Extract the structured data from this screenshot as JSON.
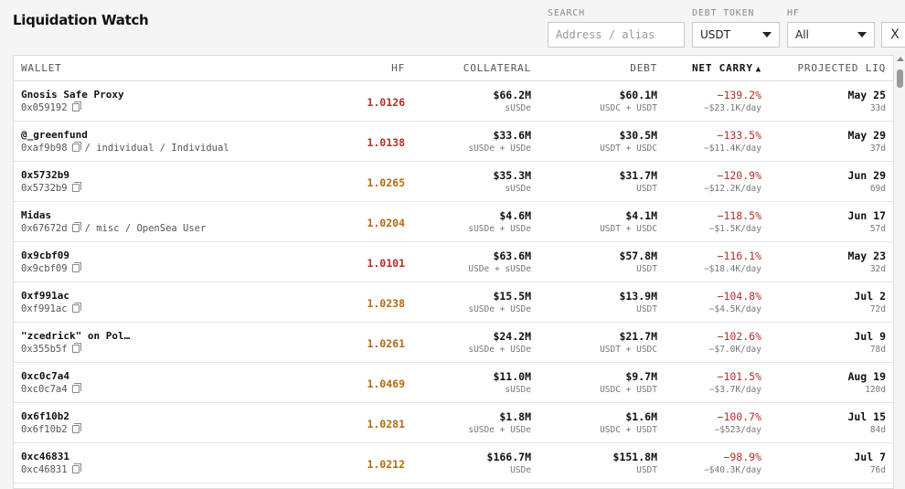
{
  "app": {
    "title": "Liquidation Watch"
  },
  "filters": {
    "search": {
      "label": "SEARCH",
      "placeholder": "Address / alias",
      "value": ""
    },
    "debt_token": {
      "label": "DEBT TOKEN",
      "value": "USDT"
    },
    "hf": {
      "label": "HF",
      "value": "All"
    },
    "clear_label": "X"
  },
  "table": {
    "columns": {
      "wallet": "WALLET",
      "hf": "HF",
      "collateral": "COLLATERAL",
      "debt": "DEBT",
      "net_carry": "NET CARRY",
      "net_carry_sort": "▲",
      "projected_liq": "PROJECTED LIQ"
    },
    "rows": [
      {
        "name": "Gnosis Safe Proxy",
        "address": "0x059192",
        "tags": "",
        "hf": "1.0126",
        "hf_level": "red",
        "collateral": "$66.2M",
        "collateral_tokens": "sUSDe",
        "debt": "$60.1M",
        "debt_tokens": "USDC + USDT",
        "net_carry": "−139.2%",
        "carry_day": "−$23.1K/day",
        "liq_date": "May 25",
        "liq_days": "33d"
      },
      {
        "name": "@_greenfund",
        "address": "0xaf9b98",
        "tags": "/ individual / Individual",
        "hf": "1.0138",
        "hf_level": "red",
        "collateral": "$33.6M",
        "collateral_tokens": "sUSDe + USDe",
        "debt": "$30.5M",
        "debt_tokens": "USDT + USDC",
        "net_carry": "−133.5%",
        "carry_day": "−$11.4K/day",
        "liq_date": "May 29",
        "liq_days": "37d"
      },
      {
        "name": "0x5732b9",
        "address": "0x5732b9",
        "tags": "",
        "hf": "1.0265",
        "hf_level": "orange",
        "collateral": "$35.3M",
        "collateral_tokens": "sUSDe",
        "debt": "$31.7M",
        "debt_tokens": "USDT",
        "net_carry": "−120.9%",
        "carry_day": "−$12.2K/day",
        "liq_date": "Jun 29",
        "liq_days": "69d"
      },
      {
        "name": "Midas",
        "address": "0x67672d",
        "tags": "/ misc / OpenSea User",
        "hf": "1.0204",
        "hf_level": "orange",
        "collateral": "$4.6M",
        "collateral_tokens": "sUSDe + USDe",
        "debt": "$4.1M",
        "debt_tokens": "USDT + USDC",
        "net_carry": "−118.5%",
        "carry_day": "−$1.5K/day",
        "liq_date": "Jun 17",
        "liq_days": "57d"
      },
      {
        "name": "0x9cbf09",
        "address": "0x9cbf09",
        "tags": "",
        "hf": "1.0101",
        "hf_level": "red",
        "collateral": "$63.6M",
        "collateral_tokens": "USDe + sUSDe",
        "debt": "$57.8M",
        "debt_tokens": "USDT",
        "net_carry": "−116.1%",
        "carry_day": "−$18.4K/day",
        "liq_date": "May 23",
        "liq_days": "32d"
      },
      {
        "name": "0xf991ac",
        "address": "0xf991ac",
        "tags": "",
        "hf": "1.0238",
        "hf_level": "orange",
        "collateral": "$15.5M",
        "collateral_tokens": "sUSDe + USDe",
        "debt": "$13.9M",
        "debt_tokens": "USDT",
        "net_carry": "−104.8%",
        "carry_day": "−$4.5K/day",
        "liq_date": "Jul 2",
        "liq_days": "72d"
      },
      {
        "name": "\"zcedrick\" on Pol…",
        "address": "0x355b5f",
        "tags": "",
        "hf": "1.0261",
        "hf_level": "orange",
        "collateral": "$24.2M",
        "collateral_tokens": "sUSDe + USDe",
        "debt": "$21.7M",
        "debt_tokens": "USDT + USDC",
        "net_carry": "−102.6%",
        "carry_day": "−$7.0K/day",
        "liq_date": "Jul 9",
        "liq_days": "78d"
      },
      {
        "name": "0xc0c7a4",
        "address": "0xc0c7a4",
        "tags": "",
        "hf": "1.0469",
        "hf_level": "orange",
        "collateral": "$11.0M",
        "collateral_tokens": "sUSDe",
        "debt": "$9.7M",
        "debt_tokens": "USDC + USDT",
        "net_carry": "−101.5%",
        "carry_day": "−$3.7K/day",
        "liq_date": "Aug 19",
        "liq_days": "120d"
      },
      {
        "name": "0x6f10b2",
        "address": "0x6f10b2",
        "tags": "",
        "hf": "1.0281",
        "hf_level": "orange",
        "collateral": "$1.8M",
        "collateral_tokens": "sUSDe + USDe",
        "debt": "$1.6M",
        "debt_tokens": "USDC + USDT",
        "net_carry": "−100.7%",
        "carry_day": "−$523/day",
        "liq_date": "Jul 15",
        "liq_days": "84d"
      },
      {
        "name": "0xc46831",
        "address": "0xc46831",
        "tags": "",
        "hf": "1.0212",
        "hf_level": "orange",
        "collateral": "$166.7M",
        "collateral_tokens": "USDe",
        "debt": "$151.8M",
        "debt_tokens": "USDT",
        "net_carry": "−98.9%",
        "carry_day": "−$40.3K/day",
        "liq_date": "Jul 7",
        "liq_days": "76d"
      }
    ]
  },
  "colors": {
    "hf_red": "#b0302a",
    "hf_orange": "#b36a16",
    "carry_negative": "#b0302a"
  }
}
